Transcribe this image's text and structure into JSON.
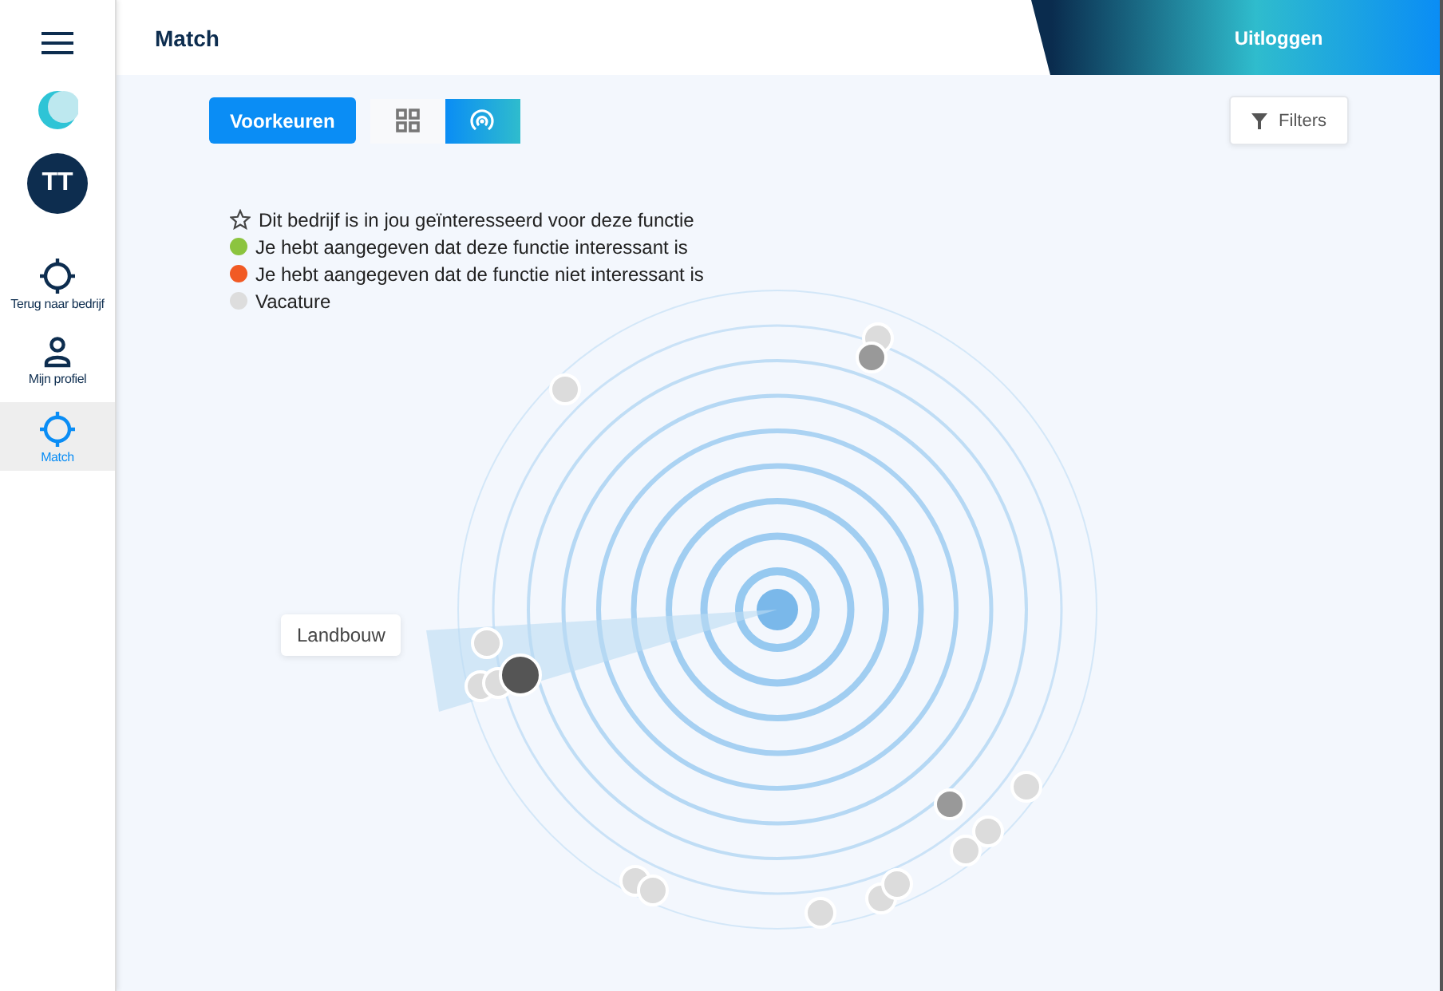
{
  "header": {
    "title": "Match",
    "logout": "Uitloggen"
  },
  "sidebar": {
    "avatar": "TT",
    "items": [
      {
        "label": "Terug naar bedrijf",
        "kind": "target",
        "selected": false
      },
      {
        "label": "Mijn profiel",
        "kind": "person",
        "selected": false
      },
      {
        "label": "Match",
        "kind": "target",
        "selected": true
      }
    ]
  },
  "toolbar": {
    "preferences": "Voorkeuren",
    "views": [
      {
        "kind": "grid",
        "selected": false
      },
      {
        "kind": "radar",
        "selected": true
      }
    ],
    "filters": "Filters"
  },
  "legend": [
    {
      "kind": "star",
      "label": "Dit bedrijf is in jou geïnteresseerd voor deze functie"
    },
    {
      "kind": "dot",
      "color": "#8cc43f",
      "label": "Je hebt aangegeven dat deze functie interessant is"
    },
    {
      "kind": "dot",
      "color": "#f15a24",
      "label": "Je hebt aangegeven dat de functie niet interessant is"
    },
    {
      "kind": "dot",
      "color": "#dddddd",
      "label": "Vacature"
    }
  ],
  "radar": {
    "sector_label": "Landbouw"
  }
}
